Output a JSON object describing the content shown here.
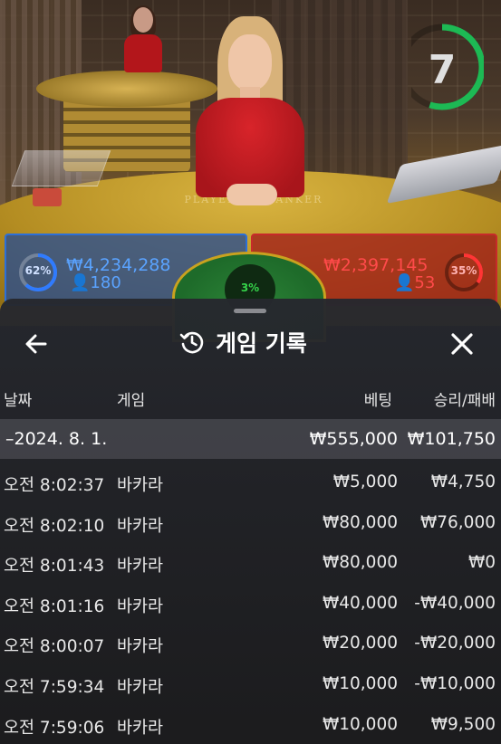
{
  "timer": {
    "value": "7",
    "fraction_remaining": 0.55,
    "color": "#1db954"
  },
  "table_felt": {
    "left": "PLAYER",
    "right": "BANKER"
  },
  "player_spot": {
    "percent": "62%",
    "amount": "₩4,234,288",
    "count": "180",
    "color": "#2c6fd8"
  },
  "banker_spot": {
    "percent": "35%",
    "amount": "₩2,397,145",
    "count": "53",
    "color": "#c72a2a"
  },
  "tie_spot": {
    "percent": "3%"
  },
  "history": {
    "title": "게임 기록",
    "icons": {
      "back": "arrow-left-icon",
      "title": "history-clock-icon",
      "close": "close-icon"
    },
    "columns": {
      "date": "날짜",
      "game": "게임",
      "bet": "베팅",
      "result": "승리/패배"
    },
    "date_group": {
      "date": "–2024. 8. 1.",
      "bet_total": "₩555,000",
      "result_total": "₩101,750"
    },
    "rows": [
      {
        "time": "오전 8:02:37",
        "game": "바카라",
        "bet": "₩5,000",
        "result": "₩4,750"
      },
      {
        "time": "오전 8:02:10",
        "game": "바카라",
        "bet": "₩80,000",
        "result": "₩76,000"
      },
      {
        "time": "오전 8:01:43",
        "game": "바카라",
        "bet": "₩80,000",
        "result": "₩0"
      },
      {
        "time": "오전 8:01:16",
        "game": "바카라",
        "bet": "₩40,000",
        "result": "-₩40,000"
      },
      {
        "time": "오전 8:00:07",
        "game": "바카라",
        "bet": "₩20,000",
        "result": "-₩20,000"
      },
      {
        "time": "오전 7:59:34",
        "game": "바카라",
        "bet": "₩10,000",
        "result": "-₩10,000"
      },
      {
        "time": "오전 7:59:06",
        "game": "바카라",
        "bet": "₩10,000",
        "result": "₩9,500"
      }
    ]
  }
}
